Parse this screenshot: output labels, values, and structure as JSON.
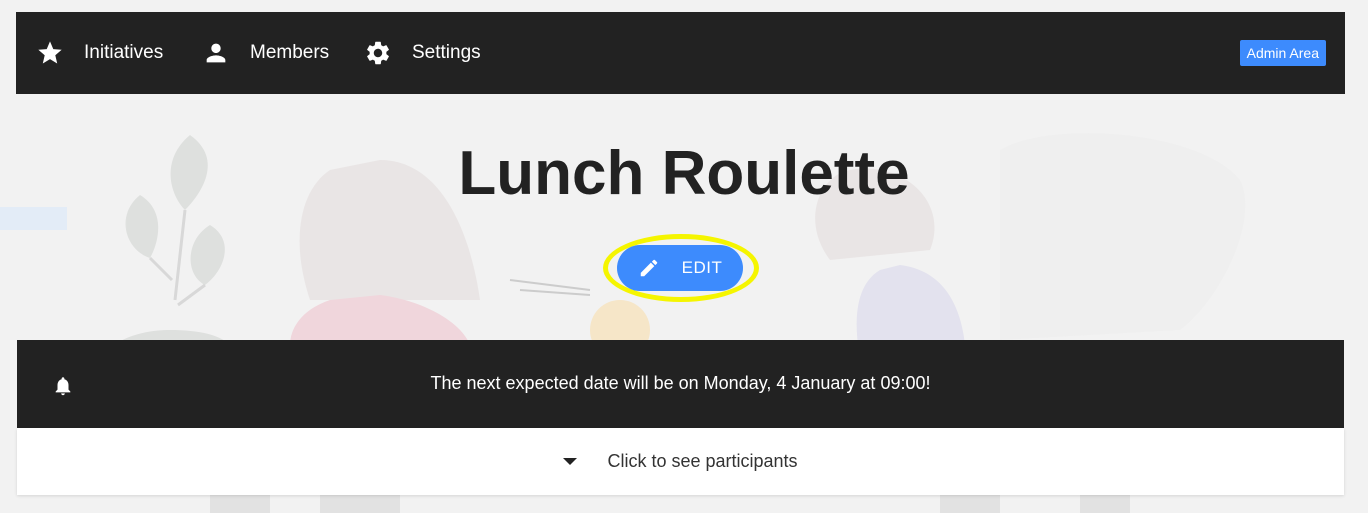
{
  "nav": {
    "items": [
      {
        "label": "Initiatives",
        "icon": "star-icon"
      },
      {
        "label": "Members",
        "icon": "person-icon"
      },
      {
        "label": "Settings",
        "icon": "gear-icon"
      }
    ],
    "admin_label": "Admin Area"
  },
  "page": {
    "title": "Lunch Roulette",
    "edit_label": "EDIT"
  },
  "notice": {
    "icon": "bell-icon",
    "text": "The next expected date will be on Monday, 4 January at 09:00!"
  },
  "participants": {
    "icon": "caret-down-icon",
    "label": "Click to see participants"
  },
  "colors": {
    "navbar": "#222222",
    "accent": "#3d8bfd",
    "highlight": "#f5f500",
    "background": "#f2f2f2"
  }
}
